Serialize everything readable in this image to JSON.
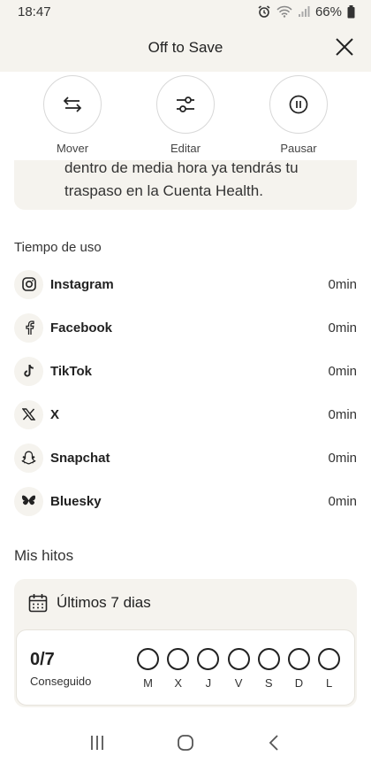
{
  "status": {
    "time": "18:47",
    "battery": "66%"
  },
  "header": {
    "title": "Off to Save"
  },
  "actions": [
    {
      "label": "Mover",
      "icon": "swap-arrows-icon"
    },
    {
      "label": "Editar",
      "icon": "sliders-icon"
    },
    {
      "label": "Pausar",
      "icon": "pause-icon"
    }
  ],
  "info": {
    "text": "dentro de media hora ya tendrás tu traspaso en la Cuenta Health."
  },
  "usage": {
    "title": "Tiempo de uso",
    "apps": [
      {
        "name": "Instagram",
        "time": "0min",
        "icon": "instagram-icon"
      },
      {
        "name": "Facebook",
        "time": "0min",
        "icon": "facebook-icon"
      },
      {
        "name": "TikTok",
        "time": "0min",
        "icon": "tiktok-icon"
      },
      {
        "name": "X",
        "time": "0min",
        "icon": "x-icon"
      },
      {
        "name": "Snapchat",
        "time": "0min",
        "icon": "snapchat-icon"
      },
      {
        "name": "Bluesky",
        "time": "0min",
        "icon": "bluesky-icon"
      }
    ]
  },
  "milestones": {
    "title": "Mis hitos",
    "period": "Últimos 7 dias",
    "score": "0/7",
    "score_label": "Conseguido",
    "days": [
      "M",
      "X",
      "J",
      "V",
      "S",
      "D",
      "L"
    ]
  },
  "colors": {
    "background": "#f5f3ee",
    "text": "#1f1f1f"
  }
}
